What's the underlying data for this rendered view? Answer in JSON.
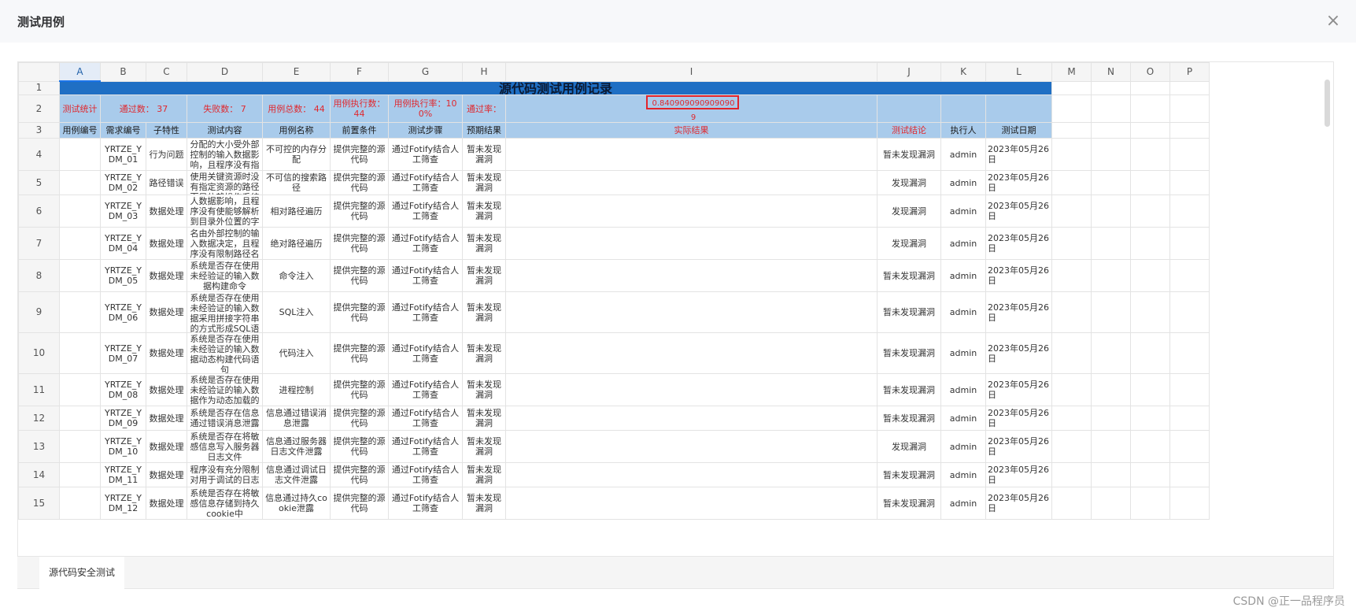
{
  "dialog": {
    "title": "测试用例",
    "close_glyph": "×"
  },
  "sheet": {
    "columns": [
      "A",
      "B",
      "C",
      "D",
      "E",
      "F",
      "G",
      "H",
      "I",
      "J",
      "K",
      "L",
      "M",
      "N",
      "O",
      "P"
    ],
    "title": "源代码测试用例记录",
    "stats": {
      "label": "测试统计",
      "pass": "通过数：    37",
      "fail": "失败数：  7",
      "total": "用例总数：  44",
      "executed": "用例执行数：  44",
      "exec_rate": "用例执行率：100%",
      "pass_rate_label": "通过率：",
      "pass_rate_value": "0.8409090909090909"
    },
    "headers": [
      "用例编号",
      "需求编号",
      "子特性",
      "测试内容",
      "用例名称",
      "前置条件",
      "测试步骤",
      "预期结果",
      "实际结果",
      "测试结论",
      "执行人",
      "测试日期"
    ],
    "rows": [
      {
        "num": "4",
        "id": "",
        "req": "YRTZE_YDM_01",
        "sub": "行为问题",
        "content": "分配的大小受外部控制的输入数据影响，且程序没有指定内存分配大小的上限",
        "name": "不可控的内存分配",
        "pre": "提供完整的源代码",
        "step": "通过Fotify结合人工筛查",
        "exp": "暂未发现漏洞",
        "act": "",
        "con": "暂未发现漏洞",
        "who": "admin",
        "date": "2023年05月26日"
      },
      {
        "num": "5",
        "id": "",
        "req": "YRTZE_YDM_02",
        "sub": "路径错误",
        "content": "使用关键资源时没有指定资源的路径而是依赖操作系统",
        "name": "不可信的搜索路径",
        "pre": "提供完整的源代码",
        "step": "通过Fotify结合人工筛查",
        "exp": "暂未发现漏洞",
        "act": "",
        "con": "发现漏洞",
        "who": "admin",
        "date": "2023年05月26日"
      },
      {
        "num": "6",
        "id": "",
        "req": "YRTZE_YDM_03",
        "sub": "数据处理",
        "content": "人数据影响，且程序没有使能够解析到目录外位置的字符序列来访问限制目录",
        "name": "相对路径遍历",
        "pre": "提供完整的源代码",
        "step": "通过Fotify结合人工筛查",
        "exp": "暂未发现漏洞",
        "act": "",
        "con": "发现漏洞",
        "who": "admin",
        "date": "2023年05月26日"
      },
      {
        "num": "7",
        "id": "",
        "req": "YRTZE_YDM_04",
        "sub": "数据处理",
        "content": "名由外部控制的输入数据决定，且程序没有限制路径名",
        "name": "绝对路径遍历",
        "pre": "提供完整的源代码",
        "step": "通过Fotify结合人工筛查",
        "exp": "暂未发现漏洞",
        "act": "",
        "con": "发现漏洞",
        "who": "admin",
        "date": "2023年05月26日"
      },
      {
        "num": "8",
        "id": "",
        "req": "YRTZE_YDM_05",
        "sub": "数据处理",
        "content": "系统是否存在使用未经验证的输入数据构建命令",
        "name": "命令注入",
        "pre": "提供完整的源代码",
        "step": "通过Fotify结合人工筛查",
        "exp": "暂未发现漏洞",
        "act": "",
        "con": "暂未发现漏洞",
        "who": "admin",
        "date": "2023年05月26日"
      },
      {
        "num": "9",
        "id": "",
        "req": "YRTZE_YDM_06",
        "sub": "数据处理",
        "content": "系统是否存在使用未经验证的输入数据采用拼接字符串的方式形成SQL语句",
        "name": "SQL注入",
        "pre": "提供完整的源代码",
        "step": "通过Fotify结合人工筛查",
        "exp": "暂未发现漏洞",
        "act": "",
        "con": "暂未发现漏洞",
        "who": "admin",
        "date": "2023年05月26日"
      },
      {
        "num": "10",
        "id": "",
        "req": "YRTZE_YDM_07",
        "sub": "数据处理",
        "content": "系统是否存在使用未经验证的输入数据动态构建代码语句",
        "name": "代码注入",
        "pre": "提供完整的源代码",
        "step": "通过Fotify结合人工筛查",
        "exp": "暂未发现漏洞",
        "act": "",
        "con": "暂未发现漏洞",
        "who": "admin",
        "date": "2023年05月26日"
      },
      {
        "num": "11",
        "id": "",
        "req": "YRTZE_YDM_08",
        "sub": "数据处理",
        "content": "系统是否存在使用未经验证的输入数据作为动态加载的库的标识符",
        "name": "进程控制",
        "pre": "提供完整的源代码",
        "step": "通过Fotify结合人工筛查",
        "exp": "暂未发现漏洞",
        "act": "",
        "con": "暂未发现漏洞",
        "who": "admin",
        "date": "2023年05月26日"
      },
      {
        "num": "12",
        "id": "",
        "req": "YRTZE_YDM_09",
        "sub": "数据处理",
        "content": "系统是否存在信息通过错误消息泄露",
        "name": "信息通过错误消息泄露",
        "pre": "提供完整的源代码",
        "step": "通过Fotify结合人工筛查",
        "exp": "暂未发现漏洞",
        "act": "",
        "con": "暂未发现漏洞",
        "who": "admin",
        "date": "2023年05月26日"
      },
      {
        "num": "13",
        "id": "",
        "req": "YRTZE_YDM_10",
        "sub": "数据处理",
        "content": "系统是否存在将敏感信息写入服务器日志文件",
        "name": "信息通过服务器日志文件泄露",
        "pre": "提供完整的源代码",
        "step": "通过Fotify结合人工筛查",
        "exp": "暂未发现漏洞",
        "act": "",
        "con": "发现漏洞",
        "who": "admin",
        "date": "2023年05月26日"
      },
      {
        "num": "14",
        "id": "",
        "req": "YRTZE_YDM_11",
        "sub": "数据处理",
        "content": "程序没有充分限制对用于调试的日志",
        "name": "信息通过调试日志文件泄露",
        "pre": "提供完整的源代码",
        "step": "通过Fotify结合人工筛查",
        "exp": "暂未发现漏洞",
        "act": "",
        "con": "暂未发现漏洞",
        "who": "admin",
        "date": "2023年05月26日"
      },
      {
        "num": "15",
        "id": "",
        "req": "YRTZE_YDM_12",
        "sub": "数据处理",
        "content": "系统是否存在将敏感信息存储到持久cookie中",
        "name": "信息通过持久cookie泄露",
        "pre": "提供完整的源代码",
        "step": "通过Fotify结合人工筛查",
        "exp": "暂未发现漏洞",
        "act": "",
        "con": "暂未发现漏洞",
        "who": "admin",
        "date": "2023年05月26日"
      }
    ]
  },
  "tabs": {
    "active": "源代码安全测试"
  },
  "watermark": "CSDN @正一品程序员"
}
